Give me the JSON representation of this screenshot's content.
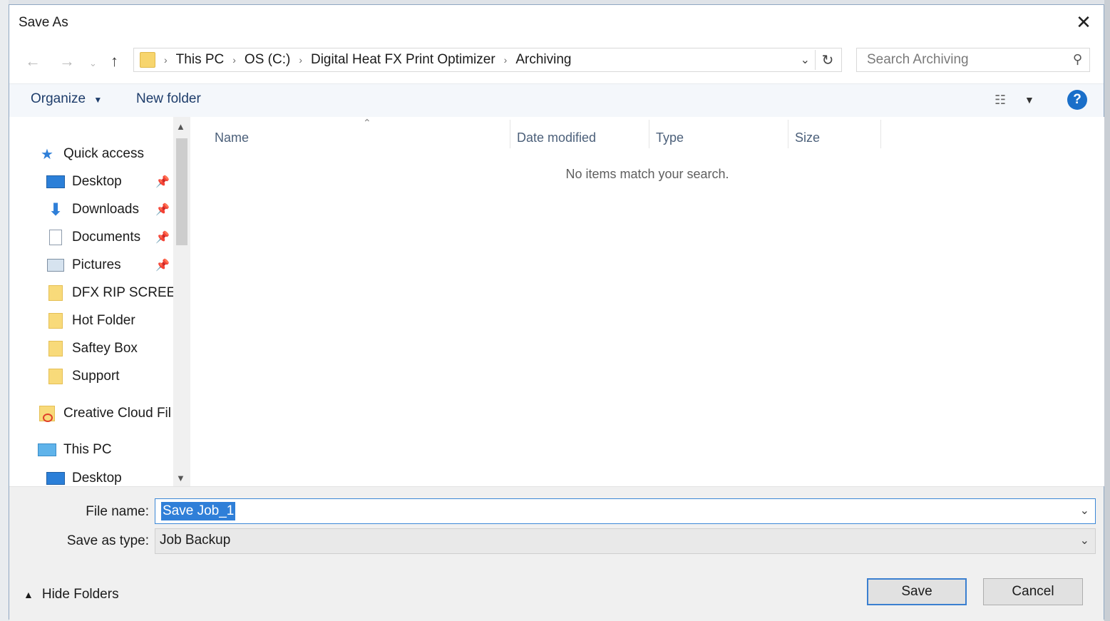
{
  "window": {
    "title": "Save As"
  },
  "address": {
    "crumbs": [
      "This PC",
      "OS (C:)",
      "Digital Heat FX Print Optimizer",
      "Archiving"
    ]
  },
  "search": {
    "placeholder": "Search Archiving"
  },
  "toolbar": {
    "organize": "Organize",
    "new_folder": "New folder"
  },
  "sidebar": {
    "quick_access": "Quick access",
    "items": [
      {
        "label": "Desktop",
        "icon": "desktop-icon",
        "pinned": true
      },
      {
        "label": "Downloads",
        "icon": "download-icon",
        "pinned": true
      },
      {
        "label": "Documents",
        "icon": "documents-icon",
        "pinned": true
      },
      {
        "label": "Pictures",
        "icon": "pictures-icon",
        "pinned": true
      },
      {
        "label": "DFX RIP SCREEN",
        "icon": "folder-icon",
        "pinned": false
      },
      {
        "label": "Hot Folder",
        "icon": "folder-icon",
        "pinned": false
      },
      {
        "label": "Saftey Box",
        "icon": "folder-icon",
        "pinned": false
      },
      {
        "label": "Support",
        "icon": "folder-icon",
        "pinned": false
      }
    ],
    "creative_cloud": "Creative Cloud Fil",
    "this_pc": "This PC",
    "this_pc_desktop": "Desktop"
  },
  "columns": {
    "name": "Name",
    "date_modified": "Date modified",
    "type": "Type",
    "size": "Size"
  },
  "empty_message": "No items match your search.",
  "form": {
    "file_name_label": "File name:",
    "file_name_value": "Save Job_1",
    "save_type_label": "Save as type:",
    "save_type_value": "Job Backup"
  },
  "footer": {
    "hide_folders": "Hide Folders",
    "save": "Save",
    "cancel": "Cancel"
  },
  "colors": {
    "accent": "#2f7fd8",
    "help": "#1a6fc9",
    "link": "#1e3d6b"
  }
}
